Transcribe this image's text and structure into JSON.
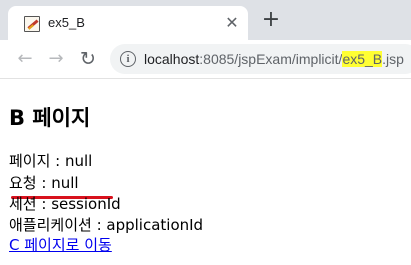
{
  "browser": {
    "tab": {
      "title": "ex5_B",
      "close_glyph": "✕"
    },
    "new_tab_glyph": "+",
    "toolbar": {
      "back_glyph": "←",
      "forward_glyph": "→",
      "reload_glyph": "↻"
    },
    "address": {
      "host": "localhost",
      "path_before": ":8085/jspExam/implicit/",
      "highlighted": "ex5_B",
      "suffix": ".jsp",
      "highlight_color": "#ffff33"
    }
  },
  "page": {
    "heading": "B 페이지",
    "lines": [
      "페이지 : null",
      "요청 : null",
      "세션 : sessionId",
      "애플리케이션 : applicationId"
    ],
    "link": "C 페이지로 이동",
    "annotation_color": "#d8111d"
  }
}
